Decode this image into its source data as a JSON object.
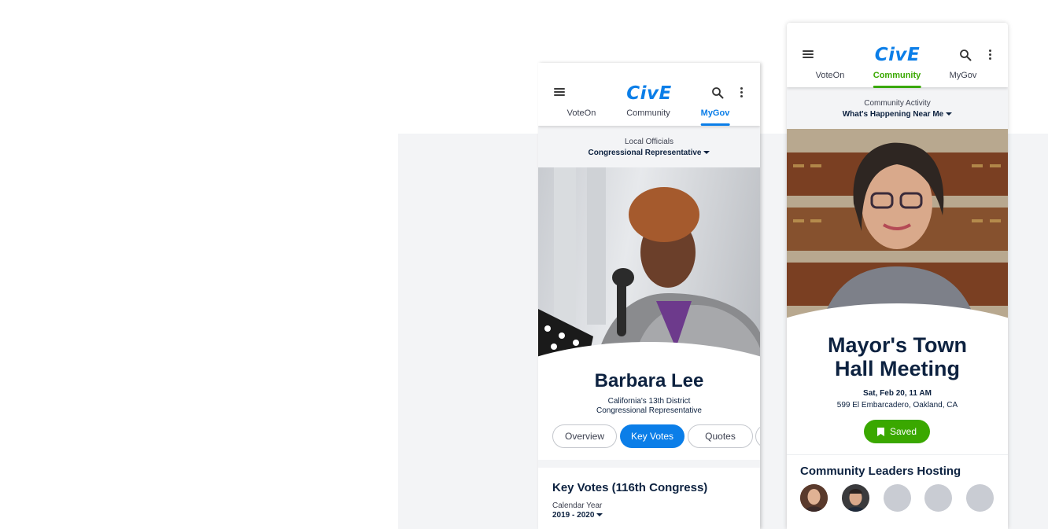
{
  "colors": {
    "brand_blue": "#0b7ee8",
    "brand_green": "#3aa800",
    "navy": "#0d2240",
    "placeholder_gray": "#c9ccd3"
  },
  "left_screen": {
    "logo": "CivE",
    "tabs": [
      {
        "label": "VoteOn"
      },
      {
        "label": "Community"
      },
      {
        "label": "MyGov"
      }
    ],
    "active_tab": "MyGov",
    "subheader": {
      "label": "Local Officials",
      "dropdown": "Congressional Representative"
    },
    "profile": {
      "name": "Barbara Lee",
      "line1": "California's 13th District",
      "line2": "Congressional Representative"
    },
    "pill_tabs": [
      {
        "label": "Overview"
      },
      {
        "label": "Key Votes"
      },
      {
        "label": "Quotes"
      }
    ],
    "selected_pill": "Key Votes",
    "key_votes": {
      "title": "Key Votes (116th Congress)",
      "filter_label": "Calendar Year",
      "filter_value": "2019 - 2020"
    }
  },
  "right_screen": {
    "logo": "CivE",
    "tabs": [
      {
        "label": "VoteOn"
      },
      {
        "label": "Community"
      },
      {
        "label": "MyGov"
      }
    ],
    "active_tab": "Community",
    "subheader": {
      "label": "Community Activity",
      "dropdown": "What's Happening Near Me"
    },
    "event": {
      "title_line1": "Mayor's Town",
      "title_line2": "Hall Meeting",
      "date": "Sat, Feb 20, 11 AM",
      "address": "599 El Embarcadero, Oakland, CA",
      "saved_label": "Saved"
    },
    "hosts": {
      "title": "Community Leaders Hosting"
    }
  }
}
